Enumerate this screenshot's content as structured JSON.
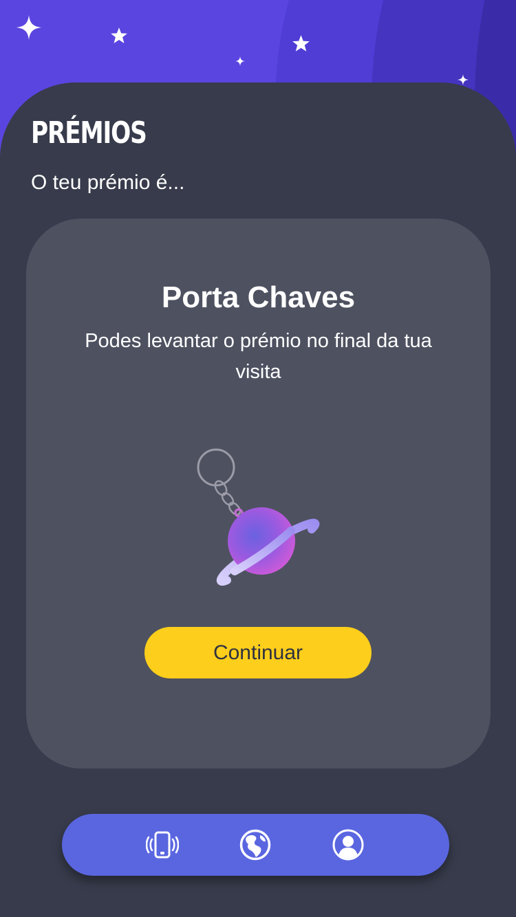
{
  "header": {
    "title": "PRÉMIOS",
    "subtitle": "O teu prémio é..."
  },
  "prize": {
    "name": "Porta Chaves",
    "description": "Podes levantar o prémio no final da tua visita",
    "image_icon": "planet-keychain-icon",
    "continue_label": "Continuar"
  },
  "bottom_nav": {
    "items": [
      {
        "icon": "vibrating-phone-icon"
      },
      {
        "icon": "globe-icon"
      },
      {
        "icon": "user-profile-icon"
      }
    ]
  },
  "colors": {
    "header_purple": "#5b45e0",
    "background": "#373b4b",
    "card": "#4e5160",
    "accent_yellow": "#fdce1b",
    "nav_blue": "#5a66e0"
  }
}
